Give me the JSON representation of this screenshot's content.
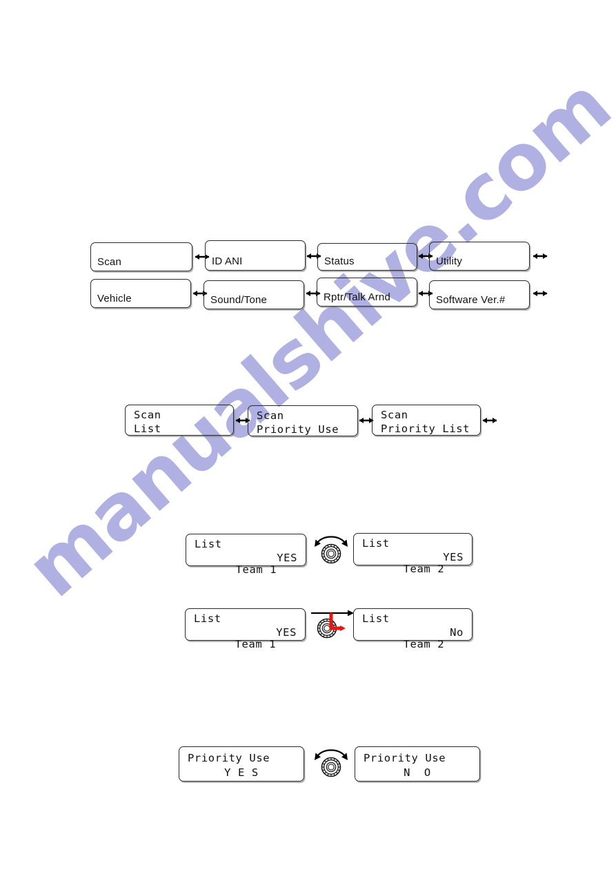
{
  "page": {
    "watermark_text": "manualshive.com",
    "watermark_color": "#b0b0e2",
    "background_color": "#ffffff",
    "accent_red": "#e8140f"
  },
  "top_menu": {
    "row1": [
      {
        "label": "Scan"
      },
      {
        "label": "ID ANI"
      },
      {
        "label": "Status"
      },
      {
        "label": "Utility"
      }
    ],
    "row2": [
      {
        "label": "Vehicle"
      },
      {
        "label": "Sound/Tone"
      },
      {
        "label": "Rptr/Talk Arnd"
      },
      {
        "label": "Software Ver.#"
      }
    ],
    "connector_icon": "double-arrow-icon"
  },
  "scan_submenu": {
    "items": [
      {
        "line1": "Scan",
        "line2": "List"
      },
      {
        "line1": "Scan",
        "line2": "Priority Use"
      },
      {
        "line1": "Scan",
        "line2": "Priority List"
      }
    ],
    "connector_icon": "double-arrow-icon"
  },
  "list_rotate": {
    "left": {
      "line1": "List",
      "line2_left": "Team 1",
      "line2_right": "YES"
    },
    "right": {
      "line1": "List",
      "line2_left": "Team 2",
      "line2_right": "YES"
    },
    "connector_icon": "rotary-knob-turn-icon"
  },
  "list_press": {
    "left": {
      "line1": "List",
      "line2_left": "Team 1",
      "line2_right": "YES"
    },
    "right": {
      "line1": "List",
      "line2_left": "Team 2",
      "line2_right": "No"
    },
    "connector_icon": "rotary-knob-press-icon",
    "marker_label": "L"
  },
  "priority_use": {
    "left": {
      "line1": "Priority Use",
      "line2": "Y E S"
    },
    "right": {
      "line1": "Priority Use",
      "line2": "N  O"
    },
    "connector_icon": "rotary-knob-turn-icon"
  }
}
